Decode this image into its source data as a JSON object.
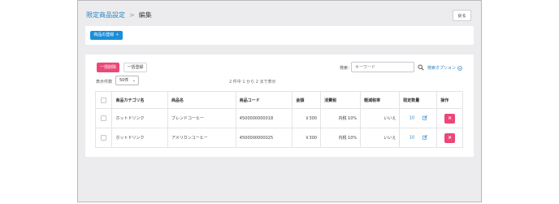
{
  "breadcrumb": {
    "parent": "限定商品設定",
    "separator": ">",
    "current": "編集"
  },
  "header": {
    "back_label": "戻る"
  },
  "toolbar": {
    "register_label": "商品の登録 ＋"
  },
  "list_controls": {
    "bulk_delete_label": "一括削除",
    "bulk_register_label": "一括登録",
    "count_label": "表示件数",
    "count_value": "50件",
    "range_text": "2 件中 1 から 2 まで表示",
    "search_label": "検索：",
    "search_placeholder": "キーワード",
    "search_option_label": "検索オプション"
  },
  "table": {
    "columns": [
      "商品カテゴリ名",
      "商品名",
      "商品コード",
      "金額",
      "消費税",
      "軽減税率",
      "限定数量",
      "操作"
    ],
    "rows": [
      {
        "category": "ホットドリンク",
        "name": "ブレンドコーヒー",
        "code": "4500000000018",
        "price": "￥300",
        "tax": "内税 10%",
        "reduced": "いいえ",
        "limit": "10",
        "delete": "×"
      },
      {
        "category": "ホットドリンク",
        "name": "アメリカンコーヒー",
        "code": "4500000000025",
        "price": "￥300",
        "tax": "内税 10%",
        "reduced": "いいえ",
        "limit": "10",
        "delete": "×"
      }
    ]
  },
  "colors": {
    "accent_blue": "#1a8fd8",
    "link_blue": "#2b84c6",
    "danger_pink": "#ec4777"
  },
  "icons": [
    "search-icon",
    "circle-chevron-down-icon",
    "edit-icon",
    "close-icon",
    "chevron-down-icon"
  ]
}
